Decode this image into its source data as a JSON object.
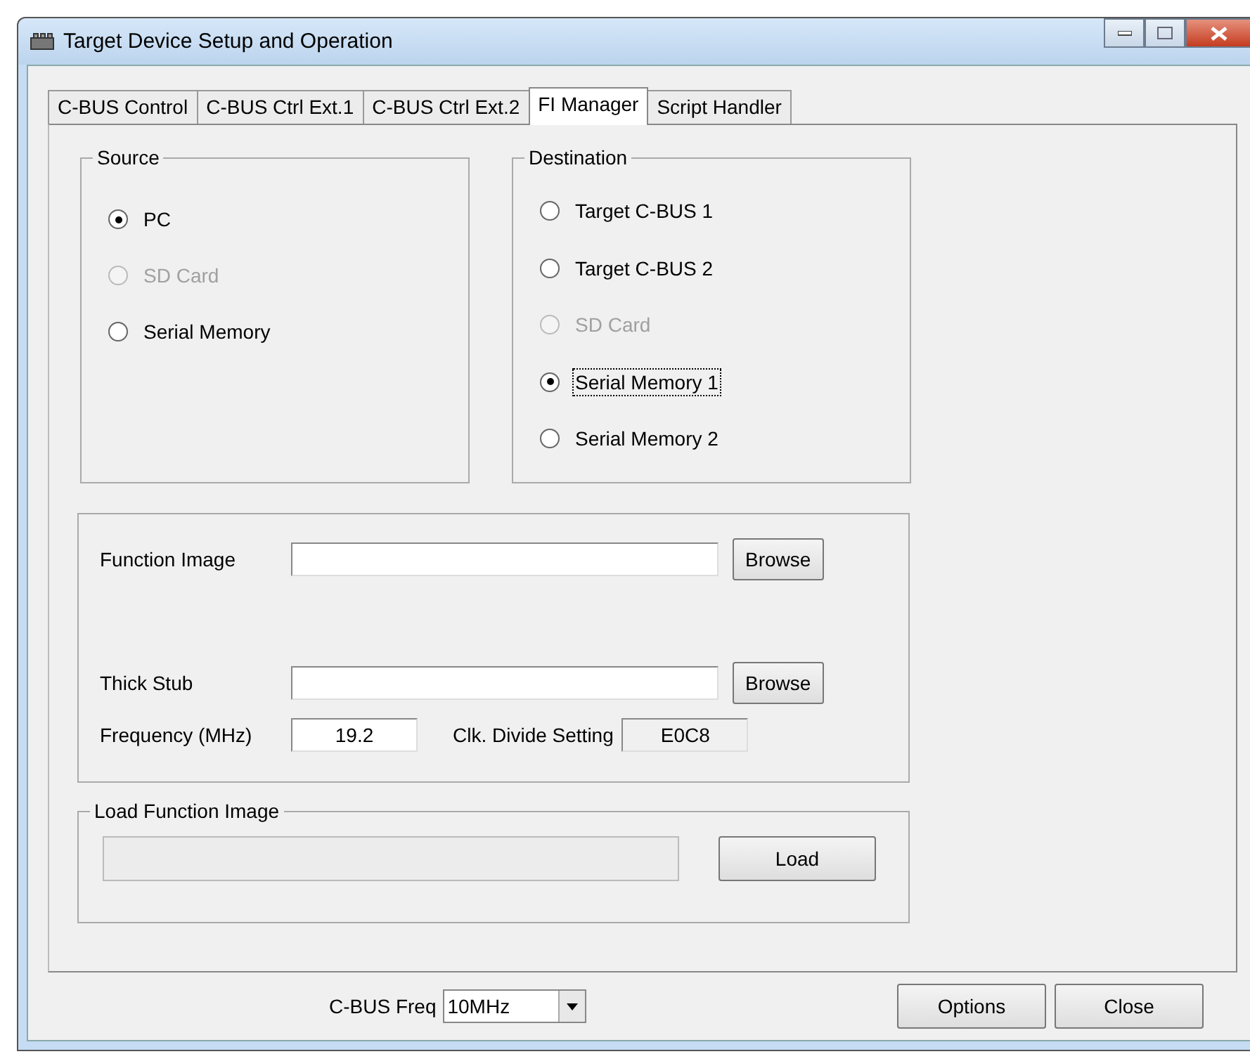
{
  "window": {
    "title": "Target Device Setup and Operation"
  },
  "tabs": [
    {
      "label": "C-BUS Control",
      "selected": false
    },
    {
      "label": "C-BUS Ctrl Ext.1",
      "selected": false
    },
    {
      "label": "C-BUS Ctrl Ext.2",
      "selected": false
    },
    {
      "label": "FI Manager",
      "selected": true
    },
    {
      "label": "Script Handler",
      "selected": false
    }
  ],
  "source": {
    "title": "Source",
    "options": [
      {
        "label": "PC",
        "selected": true,
        "disabled": false,
        "focused": false
      },
      {
        "label": "SD Card",
        "selected": false,
        "disabled": true,
        "focused": false
      },
      {
        "label": "Serial Memory",
        "selected": false,
        "disabled": false,
        "focused": false
      }
    ]
  },
  "destination": {
    "title": "Destination",
    "options": [
      {
        "label": "Target C-BUS 1",
        "selected": false,
        "disabled": false,
        "focused": false
      },
      {
        "label": "Target C-BUS 2",
        "selected": false,
        "disabled": false,
        "focused": false
      },
      {
        "label": "SD Card",
        "selected": false,
        "disabled": true,
        "focused": false
      },
      {
        "label": "Serial Memory 1",
        "selected": true,
        "disabled": false,
        "focused": true
      },
      {
        "label": "Serial Memory 2",
        "selected": false,
        "disabled": false,
        "focused": false
      }
    ]
  },
  "file_fields": [
    {
      "label": "Function Image",
      "button": "Browse"
    },
    {
      "label": "Thick Stub",
      "button": "Browse"
    }
  ],
  "frequency": {
    "label": "Frequency (MHz)",
    "value": "19.2"
  },
  "clk_divide": {
    "label": "Clk. Divide Setting",
    "value": "E0C8"
  },
  "load_group": {
    "title": "Load Function Image",
    "button": "Load",
    "level": 0
  },
  "cbus_freq": {
    "label": "C-BUS Freq",
    "value": "10MHz"
  },
  "buttons": [
    "Options",
    "Close"
  ]
}
